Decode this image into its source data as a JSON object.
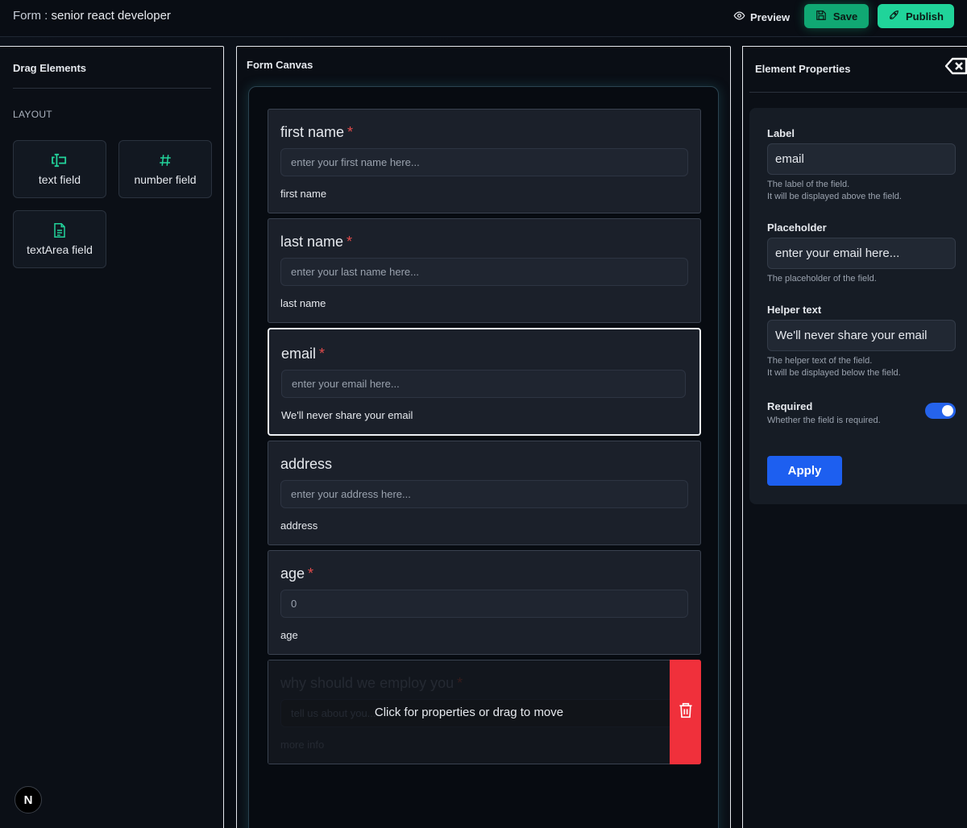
{
  "header": {
    "title_prefix": "Form : ",
    "form_name": "senior react developer",
    "preview_label": "Preview",
    "save_label": "Save",
    "publish_label": "Publish"
  },
  "colors": {
    "accent_green": "#10a873",
    "publish_green": "#20d49a",
    "required_red": "#e24b4b",
    "delete_red": "#f0303b",
    "primary_blue": "#1d5ff0"
  },
  "sidebar": {
    "title": "Drag Elements",
    "section": "LAYOUT",
    "tools": [
      {
        "label": "text field",
        "icon": "text-cursor-icon"
      },
      {
        "label": "number field",
        "icon": "hash-icon"
      },
      {
        "label": "textArea field",
        "icon": "document-icon"
      }
    ]
  },
  "canvas": {
    "title": "Form Canvas",
    "fields": [
      {
        "label": "first name",
        "required": "*",
        "placeholder": "enter your first name here...",
        "helper": "first name"
      },
      {
        "label": "last name",
        "required": "*",
        "placeholder": "enter your last name here...",
        "helper": "last name"
      },
      {
        "label": "email",
        "required": "*",
        "placeholder": "enter your email here...",
        "helper": "We'll never share your email"
      },
      {
        "label": "address",
        "required": "",
        "placeholder": "enter your address here...",
        "helper": "address"
      },
      {
        "label": "age",
        "required": "*",
        "placeholder": "0",
        "helper": "age"
      },
      {
        "label": "why should we employ you",
        "required": "*",
        "placeholder": "tell us about you...",
        "helper": "more info"
      }
    ],
    "hover_overlay": "Click for properties or drag to move"
  },
  "properties": {
    "title": "Element Properties",
    "label_title": "Label",
    "label_value": "email",
    "label_desc_1": "The label of the field.",
    "label_desc_2": "It will be displayed above the field.",
    "placeholder_title": "Placeholder",
    "placeholder_value": "enter your email here...",
    "placeholder_desc": "The placeholder of the field.",
    "helper_title": "Helper text",
    "helper_value": "We'll never share your email",
    "helper_desc_1": "The helper text of the field.",
    "helper_desc_2": "It will be displayed below the field.",
    "required_title": "Required",
    "required_desc": "Whether the field is required.",
    "required_on": true,
    "apply_label": "Apply"
  },
  "badge": "N"
}
